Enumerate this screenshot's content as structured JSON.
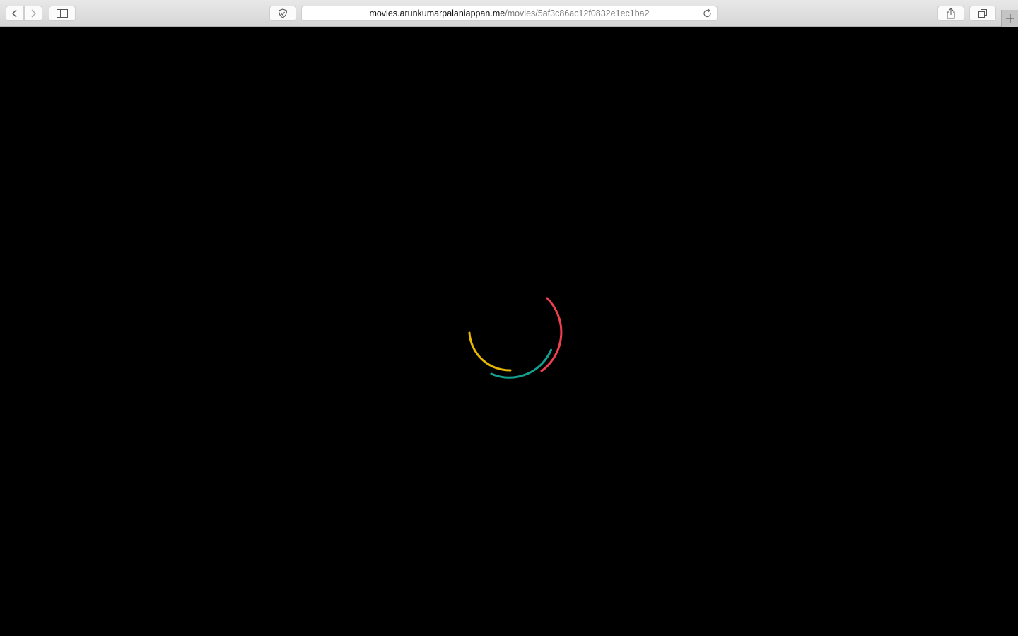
{
  "browser": {
    "url_host": "movies.arunkumarpalaniappan.me",
    "url_path": "/movies/5af3c86ac12f0832e1ec1ba2",
    "icons": [
      "back-icon",
      "forward-icon",
      "sidebar-icon",
      "shield-icon",
      "reload-icon",
      "share-icon",
      "tabs-icon",
      "plus-icon"
    ]
  },
  "spinner": {
    "colors": {
      "red": "#f0404f",
      "teal": "#14a090",
      "yellow": "#e6b800"
    }
  }
}
